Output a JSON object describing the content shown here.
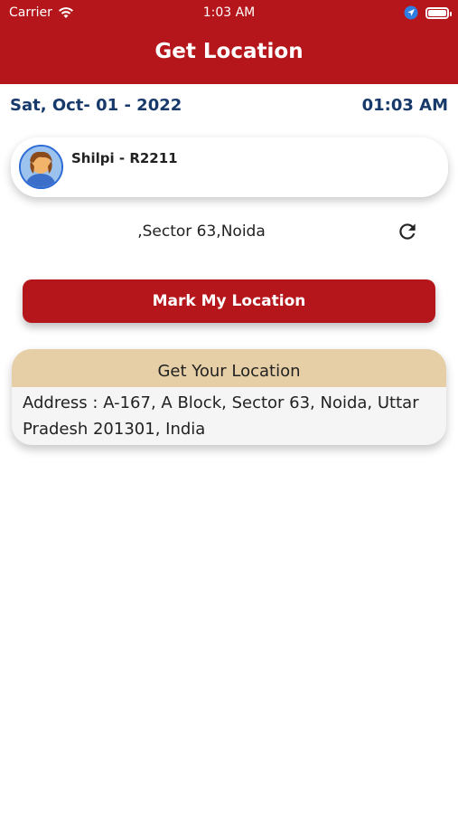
{
  "status_bar": {
    "carrier": "Carrier",
    "time": "1:03 AM",
    "icons": [
      "wifi-icon",
      "location-arrow-icon",
      "battery-icon"
    ]
  },
  "header": {
    "title": "Get Location"
  },
  "date_time": {
    "date": "Sat, Oct- 01 - 2022",
    "time": "01:03 AM"
  },
  "user": {
    "name": "Shilpi  - R2211"
  },
  "location": {
    "text": ",Sector 63,Noida",
    "refresh_icon": "refresh-icon"
  },
  "actions": {
    "mark_label": "Mark My Location"
  },
  "address_card": {
    "heading": "Get Your Location",
    "address": "Address  : A-167, A Block, Sector 63, Noida, Uttar Pradesh 201301, India"
  },
  "colors": {
    "primary": "#b5161b",
    "date_text": "#173a6b",
    "card_header": "#e6cfa6"
  }
}
